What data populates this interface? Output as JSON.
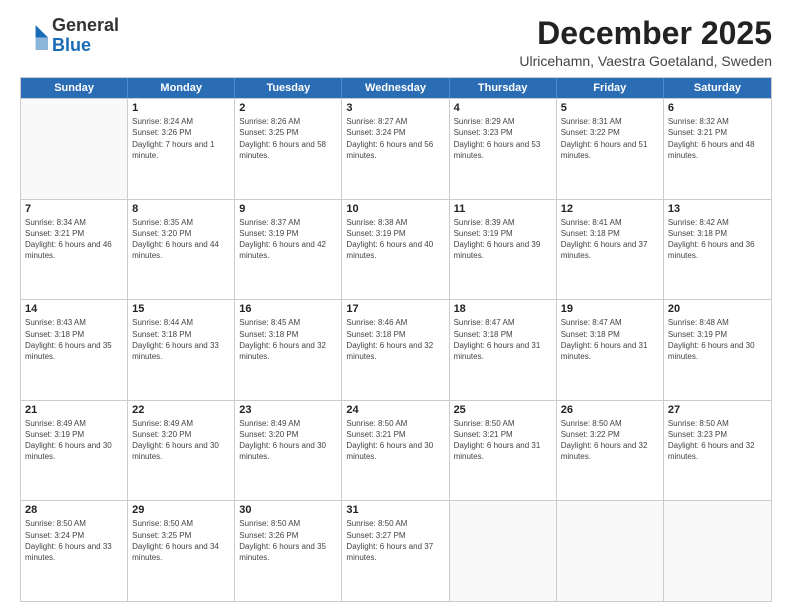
{
  "logo": {
    "general": "General",
    "blue": "Blue"
  },
  "header": {
    "month": "December 2025",
    "location": "Ulricehamn, Vaestra Goetaland, Sweden"
  },
  "days": [
    "Sunday",
    "Monday",
    "Tuesday",
    "Wednesday",
    "Thursday",
    "Friday",
    "Saturday"
  ],
  "weeks": [
    [
      {
        "day": "",
        "empty": true
      },
      {
        "day": "1",
        "sunrise": "8:24 AM",
        "sunset": "3:26 PM",
        "daylight": "7 hours and 1 minute."
      },
      {
        "day": "2",
        "sunrise": "8:26 AM",
        "sunset": "3:25 PM",
        "daylight": "6 hours and 58 minutes."
      },
      {
        "day": "3",
        "sunrise": "8:27 AM",
        "sunset": "3:24 PM",
        "daylight": "6 hours and 56 minutes."
      },
      {
        "day": "4",
        "sunrise": "8:29 AM",
        "sunset": "3:23 PM",
        "daylight": "6 hours and 53 minutes."
      },
      {
        "day": "5",
        "sunrise": "8:31 AM",
        "sunset": "3:22 PM",
        "daylight": "6 hours and 51 minutes."
      },
      {
        "day": "6",
        "sunrise": "8:32 AM",
        "sunset": "3:21 PM",
        "daylight": "6 hours and 48 minutes."
      }
    ],
    [
      {
        "day": "7",
        "sunrise": "8:34 AM",
        "sunset": "3:21 PM",
        "daylight": "6 hours and 46 minutes."
      },
      {
        "day": "8",
        "sunrise": "8:35 AM",
        "sunset": "3:20 PM",
        "daylight": "6 hours and 44 minutes."
      },
      {
        "day": "9",
        "sunrise": "8:37 AM",
        "sunset": "3:19 PM",
        "daylight": "6 hours and 42 minutes."
      },
      {
        "day": "10",
        "sunrise": "8:38 AM",
        "sunset": "3:19 PM",
        "daylight": "6 hours and 40 minutes."
      },
      {
        "day": "11",
        "sunrise": "8:39 AM",
        "sunset": "3:19 PM",
        "daylight": "6 hours and 39 minutes."
      },
      {
        "day": "12",
        "sunrise": "8:41 AM",
        "sunset": "3:18 PM",
        "daylight": "6 hours and 37 minutes."
      },
      {
        "day": "13",
        "sunrise": "8:42 AM",
        "sunset": "3:18 PM",
        "daylight": "6 hours and 36 minutes."
      }
    ],
    [
      {
        "day": "14",
        "sunrise": "8:43 AM",
        "sunset": "3:18 PM",
        "daylight": "6 hours and 35 minutes."
      },
      {
        "day": "15",
        "sunrise": "8:44 AM",
        "sunset": "3:18 PM",
        "daylight": "6 hours and 33 minutes."
      },
      {
        "day": "16",
        "sunrise": "8:45 AM",
        "sunset": "3:18 PM",
        "daylight": "6 hours and 32 minutes."
      },
      {
        "day": "17",
        "sunrise": "8:46 AM",
        "sunset": "3:18 PM",
        "daylight": "6 hours and 32 minutes."
      },
      {
        "day": "18",
        "sunrise": "8:47 AM",
        "sunset": "3:18 PM",
        "daylight": "6 hours and 31 minutes."
      },
      {
        "day": "19",
        "sunrise": "8:47 AM",
        "sunset": "3:18 PM",
        "daylight": "6 hours and 31 minutes."
      },
      {
        "day": "20",
        "sunrise": "8:48 AM",
        "sunset": "3:19 PM",
        "daylight": "6 hours and 30 minutes."
      }
    ],
    [
      {
        "day": "21",
        "sunrise": "8:49 AM",
        "sunset": "3:19 PM",
        "daylight": "6 hours and 30 minutes."
      },
      {
        "day": "22",
        "sunrise": "8:49 AM",
        "sunset": "3:20 PM",
        "daylight": "6 hours and 30 minutes."
      },
      {
        "day": "23",
        "sunrise": "8:49 AM",
        "sunset": "3:20 PM",
        "daylight": "6 hours and 30 minutes."
      },
      {
        "day": "24",
        "sunrise": "8:50 AM",
        "sunset": "3:21 PM",
        "daylight": "6 hours and 30 minutes."
      },
      {
        "day": "25",
        "sunrise": "8:50 AM",
        "sunset": "3:21 PM",
        "daylight": "6 hours and 31 minutes."
      },
      {
        "day": "26",
        "sunrise": "8:50 AM",
        "sunset": "3:22 PM",
        "daylight": "6 hours and 32 minutes."
      },
      {
        "day": "27",
        "sunrise": "8:50 AM",
        "sunset": "3:23 PM",
        "daylight": "6 hours and 32 minutes."
      }
    ],
    [
      {
        "day": "28",
        "sunrise": "8:50 AM",
        "sunset": "3:24 PM",
        "daylight": "6 hours and 33 minutes."
      },
      {
        "day": "29",
        "sunrise": "8:50 AM",
        "sunset": "3:25 PM",
        "daylight": "6 hours and 34 minutes."
      },
      {
        "day": "30",
        "sunrise": "8:50 AM",
        "sunset": "3:26 PM",
        "daylight": "6 hours and 35 minutes."
      },
      {
        "day": "31",
        "sunrise": "8:50 AM",
        "sunset": "3:27 PM",
        "daylight": "6 hours and 37 minutes."
      },
      {
        "day": "",
        "empty": true
      },
      {
        "day": "",
        "empty": true
      },
      {
        "day": "",
        "empty": true
      }
    ]
  ]
}
